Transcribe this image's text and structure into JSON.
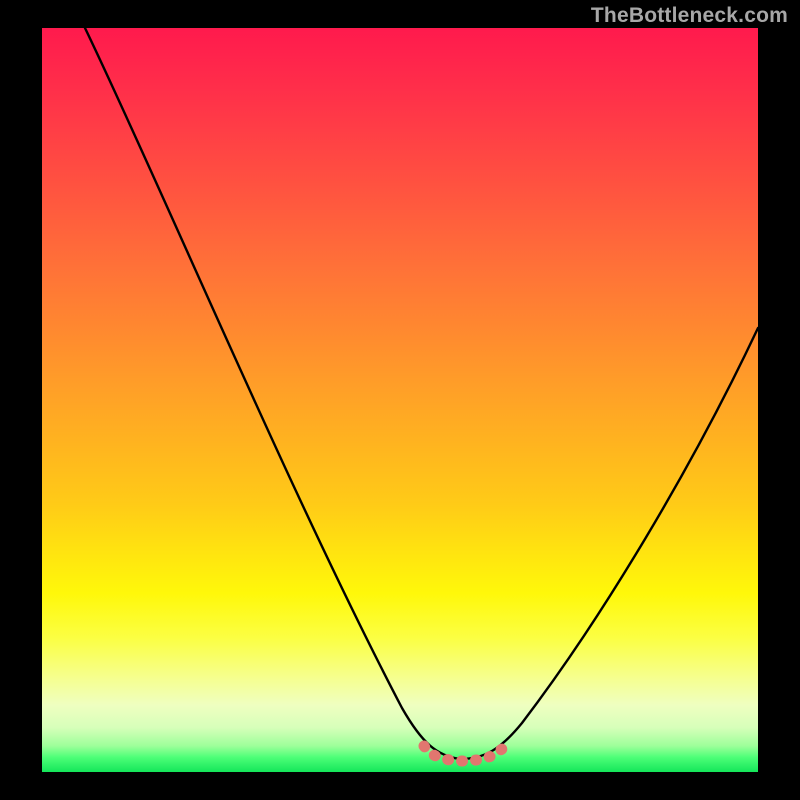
{
  "watermark": "TheBottleneck.com",
  "colors": {
    "frame": "#000000",
    "curve": "#000000",
    "flat_marker": "#e2766f",
    "gradient_top": "#ff1a4d",
    "gradient_bottom": "#14e65a"
  },
  "chart_data": {
    "type": "line",
    "title": "",
    "xlabel": "",
    "ylabel": "",
    "xlim": [
      0,
      100
    ],
    "ylim": [
      0,
      100
    ],
    "grid": false,
    "annotations": [
      "TheBottleneck.com"
    ],
    "note": "V-shaped bottleneck curve over a vertical heat gradient. No numeric axis ticks are shown in the image; x/y below are read as percentage of plot width/height (0,0 = top-left of plot area, 100,100 = bottom-right) so the curve shape is recoverable.",
    "series": [
      {
        "name": "bottleneck-curve",
        "x": [
          6,
          10,
          15,
          20,
          25,
          30,
          35,
          40,
          45,
          50,
          53,
          55,
          57,
          59,
          61,
          63,
          65,
          68,
          72,
          76,
          80,
          84,
          88,
          92,
          96,
          100
        ],
        "y": [
          0,
          8,
          17,
          26,
          35,
          44,
          53,
          62,
          72,
          82,
          89,
          93,
          96,
          97.5,
          98,
          97.5,
          96,
          93,
          88,
          82,
          75,
          68,
          61,
          54,
          47,
          40
        ]
      },
      {
        "name": "flat-bottom-marker",
        "x": [
          55,
          56,
          57,
          58,
          59,
          60,
          61,
          62,
          63,
          64,
          65
        ],
        "y": [
          97,
          97.7,
          98.1,
          98.3,
          98.4,
          98.4,
          98.4,
          98.3,
          98.1,
          97.6,
          96.8
        ]
      }
    ]
  }
}
